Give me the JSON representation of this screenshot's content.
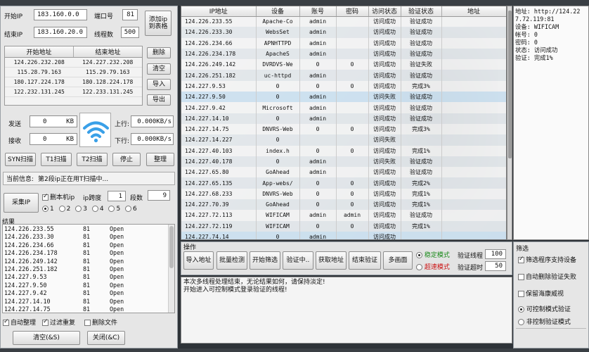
{
  "left": {
    "start_ip_label": "开始IP",
    "start_ip": "183.160.0.0",
    "port_label": "端口号",
    "port": "81",
    "end_ip_label": "结束IP",
    "end_ip": "183.160.20.0",
    "threads_label": "线程数",
    "threads": "500",
    "add_button": "添加ip到表格",
    "range_table": {
      "headers": [
        "开始地址",
        "结束地址"
      ],
      "rows": [
        [
          "124.226.232.208",
          "124.227.232.208"
        ],
        [
          "115.28.79.163",
          "115.29.79.163"
        ],
        [
          "180.127.224.178",
          "180.128.224.178"
        ],
        [
          "122.232.131.245",
          "122.233.131.245"
        ]
      ]
    },
    "delete_button": "删除",
    "clear_button": "清空",
    "import_button": "导入",
    "export_button": "导出",
    "send_label": "发送",
    "send_value": "0",
    "send_unit": "KB",
    "recv_label": "接收",
    "recv_value": "0",
    "recv_unit": "KB",
    "up_label": "上行:",
    "up_value": "0.000KB/s",
    "down_label": "下行:",
    "down_value": "0.000KB/s",
    "syn_button": "SYN扫描",
    "t1_button": "T1扫描",
    "t2_button": "T2扫描",
    "stop_button": "停止",
    "sort_button": "整理",
    "info_label": "当前信息:",
    "info_text": "第2段ip正在用T扫描中...",
    "collect_button": "采集IP",
    "local_ip_label": "删本机ip",
    "ip_span_label": "ip跨度",
    "ip_span_value": "1",
    "segment_label": "段数",
    "segment_value": "9",
    "radios": [
      "1",
      "2",
      "3",
      "4",
      "5",
      "6"
    ],
    "results_label": "结果",
    "results": [
      [
        "124.226.233.55",
        "81",
        "Open"
      ],
      [
        "124.226.233.30",
        "81",
        "Open"
      ],
      [
        "124.226.234.66",
        "81",
        "Open"
      ],
      [
        "124.226.234.178",
        "81",
        "Open"
      ],
      [
        "124.226.249.142",
        "81",
        "Open"
      ],
      [
        "124.226.251.182",
        "81",
        "Open"
      ],
      [
        "124.227.9.53",
        "81",
        "Open"
      ],
      [
        "124.227.9.50",
        "81",
        "Open"
      ],
      [
        "124.227.9.42",
        "81",
        "Open"
      ],
      [
        "124.227.14.10",
        "81",
        "Open"
      ],
      [
        "124.227.14.75",
        "81",
        "Open"
      ]
    ],
    "auto_sort_label": "自动整理",
    "filter_dup_label": "过滤重复",
    "delete_file_label": "删除文件",
    "clear_as_button": "清空(&S)",
    "close_button": "关闭(&C)"
  },
  "grid": {
    "headers": [
      "IP地址",
      "设备",
      "账号",
      "密码",
      "访问状态",
      "验证状态",
      "地址"
    ],
    "selected": [
      7,
      20
    ],
    "rows": [
      [
        "124.226.233.55",
        "Apache-Co",
        "admin",
        "",
        "访问成功",
        "验证成功",
        ""
      ],
      [
        "124.226.233.30",
        "WebsSet",
        "admin",
        "",
        "访问成功",
        "验证成功",
        ""
      ],
      [
        "124.226.234.66",
        "APNHTTPD",
        "admin",
        "",
        "访问成功",
        "验证成功",
        ""
      ],
      [
        "124.226.234.178",
        "ApacheS",
        "admin",
        "",
        "访问成功",
        "验证成功",
        ""
      ],
      [
        "124.226.249.142",
        "DVRDVS-We",
        "0",
        "0",
        "访问成功",
        "验证失败",
        ""
      ],
      [
        "124.226.251.182",
        "uc-httpd",
        "admin",
        "",
        "访问成功",
        "验证成功",
        ""
      ],
      [
        "124.227.9.53",
        "0",
        "0",
        "0",
        "访问成功",
        "完成3%",
        ""
      ],
      [
        "124.227.9.50",
        "0",
        "admin",
        "",
        "访问失败",
        "验证成功",
        ""
      ],
      [
        "124.227.9.42",
        "Microsoft",
        "admin",
        "",
        "访问成功",
        "验证成功",
        ""
      ],
      [
        "124.227.14.10",
        "0",
        "admin",
        "",
        "访问成功",
        "验证成功",
        ""
      ],
      [
        "124.227.14.75",
        "DNVRS-Web",
        "0",
        "0",
        "访问成功",
        "完成3%",
        ""
      ],
      [
        "124.227.14.227",
        "0",
        "",
        "",
        "访问失败",
        "",
        ""
      ],
      [
        "124.227.40.103",
        "index.h",
        "0",
        "0",
        "访问成功",
        "完成1%",
        ""
      ],
      [
        "124.227.40.178",
        "0",
        "admin",
        "",
        "访问失败",
        "验证成功",
        ""
      ],
      [
        "124.227.65.80",
        "GoAhead",
        "admin",
        "",
        "访问成功",
        "验证成功",
        ""
      ],
      [
        "124.227.65.135",
        "App-webs/",
        "0",
        "0",
        "访问成功",
        "完成2%",
        ""
      ],
      [
        "124.227.68.233",
        "DNVRS-Web",
        "0",
        "0",
        "访问成功",
        "完成1%",
        ""
      ],
      [
        "124.227.70.39",
        "GoAhead",
        "0",
        "0",
        "访问成功",
        "完成1%",
        ""
      ],
      [
        "124.227.72.113",
        "WIFICAM",
        "admin",
        "admin",
        "访问成功",
        "验证成功",
        ""
      ],
      [
        "124.227.72.119",
        "WIFICAM",
        "0",
        "0",
        "访问成功",
        "完成1%",
        ""
      ],
      [
        "124.227.74.14",
        "0",
        "admin",
        "",
        "访问成功",
        "",
        ""
      ]
    ]
  },
  "info_panel": {
    "lines": [
      "地址: http://124.22",
      "7.72.119:81",
      "设备: WIFICAM",
      "帐号: 0",
      "密码: 0",
      "状态: 访问成功",
      "验证: 完成1%"
    ]
  },
  "ops": {
    "label": "操作",
    "import_addr": "导入地址",
    "batch_detect": "批量检测",
    "start_filter": "开始筛选",
    "verifying": "验证中..",
    "get_addr": "获取地址",
    "end_verify": "结束验证",
    "multi_screen": "多画面",
    "stable_mode": "稳定模式",
    "fast_mode": "超速模式",
    "verify_threads_label": "验证线程",
    "verify_threads": "100",
    "verify_timeout_label": "验证超时",
    "verify_timeout": "50"
  },
  "log": {
    "lines": [
      "本次多线程处理结束，无论结果如何，请保持淡定!",
      "开始进入可控制模式登录验证的线程!"
    ]
  },
  "filter": {
    "label": "筛选",
    "opt1": "筛选程序支持设备",
    "opt2": "自动删除验证失败",
    "opt3": "保留海康威视",
    "opt4": "可控制模式验证",
    "opt5": "非控制验证模式"
  },
  "colors": {
    "stable": "#1a8a1a",
    "fast": "#cc1111",
    "wifi": "#3aa0e8"
  }
}
